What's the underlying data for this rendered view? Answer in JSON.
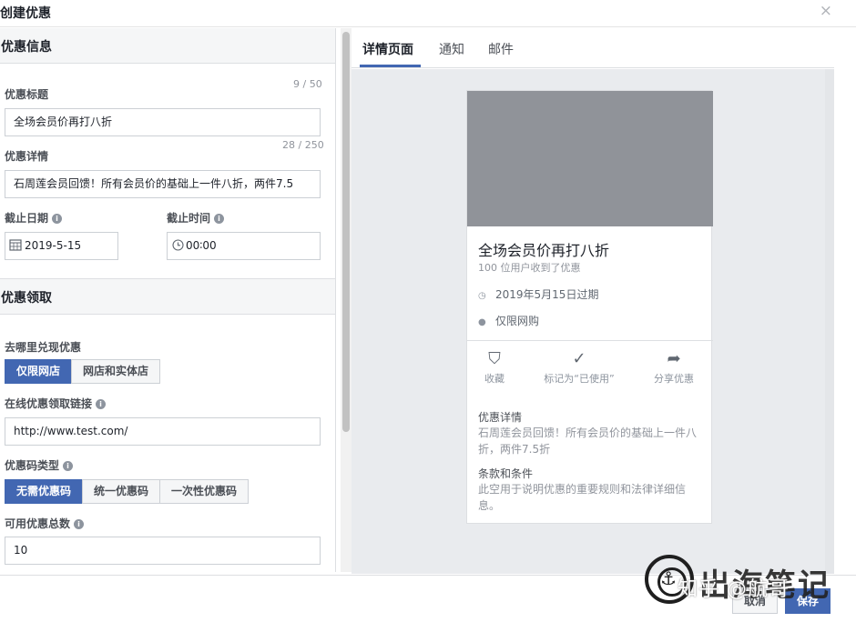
{
  "dialog": {
    "title": "创建优惠",
    "close_label": "×"
  },
  "offer_info": {
    "section_title": "优惠信息",
    "title_label": "优惠标题",
    "title_counter": "9 / 50",
    "title_value": "全场会员价再打八折",
    "details_label": "优惠详情",
    "details_counter": "28 / 250",
    "details_value": "石周莲会员回馈！所有会员价的基础上一件八折，两件7.5",
    "end_date_label": "截止日期",
    "end_date_value": "2019-5-15",
    "end_time_label": "截止时间",
    "end_time_value": "00∶00"
  },
  "offer_claim": {
    "section_title": "优惠领取",
    "where_label": "去哪里兑现优惠",
    "where_options": [
      "仅限网店",
      "网店和实体店"
    ],
    "link_label": "在线优惠领取链接",
    "link_value": "http://www.test.com/",
    "code_type_label": "优惠码类型",
    "code_type_options": [
      "无需优惠码",
      "统一优惠码",
      "一次性优惠码"
    ],
    "total_label": "可用优惠总数",
    "total_value": "10"
  },
  "preview": {
    "tabs": [
      "详情页面",
      "通知",
      "邮件"
    ],
    "card": {
      "title": "全场会员价再打八折",
      "subtitle": "100 位用户收到了优惠",
      "expiry": "2019年5月15日过期",
      "scope": "仅限网购",
      "actions": [
        "收藏",
        "标记为“已使用”",
        "分享优惠"
      ],
      "details_heading": "优惠详情",
      "details_text": "石周莲会员回馈！所有会员价的基础上一件八折，两件7.5折",
      "terms_heading": "条款和条件",
      "terms_text": "此空用于说明优惠的重要规则和法律详细信息。"
    }
  },
  "footer": {
    "cancel_label": "取消",
    "save_label": "保存"
  },
  "watermark": {
    "text": "出海笔记",
    "overlay": "知乎 @航哥"
  },
  "colors": {
    "accent": "#4267b2",
    "panel_bg": "#e9ebee",
    "image_placeholder": "#909399"
  },
  "icons": [
    "close-icon",
    "help-icon",
    "calendar-icon",
    "clock-icon",
    "clock-small-icon",
    "globe-icon",
    "bookmark-icon",
    "check-icon",
    "share-icon",
    "anchor-logo-icon"
  ]
}
